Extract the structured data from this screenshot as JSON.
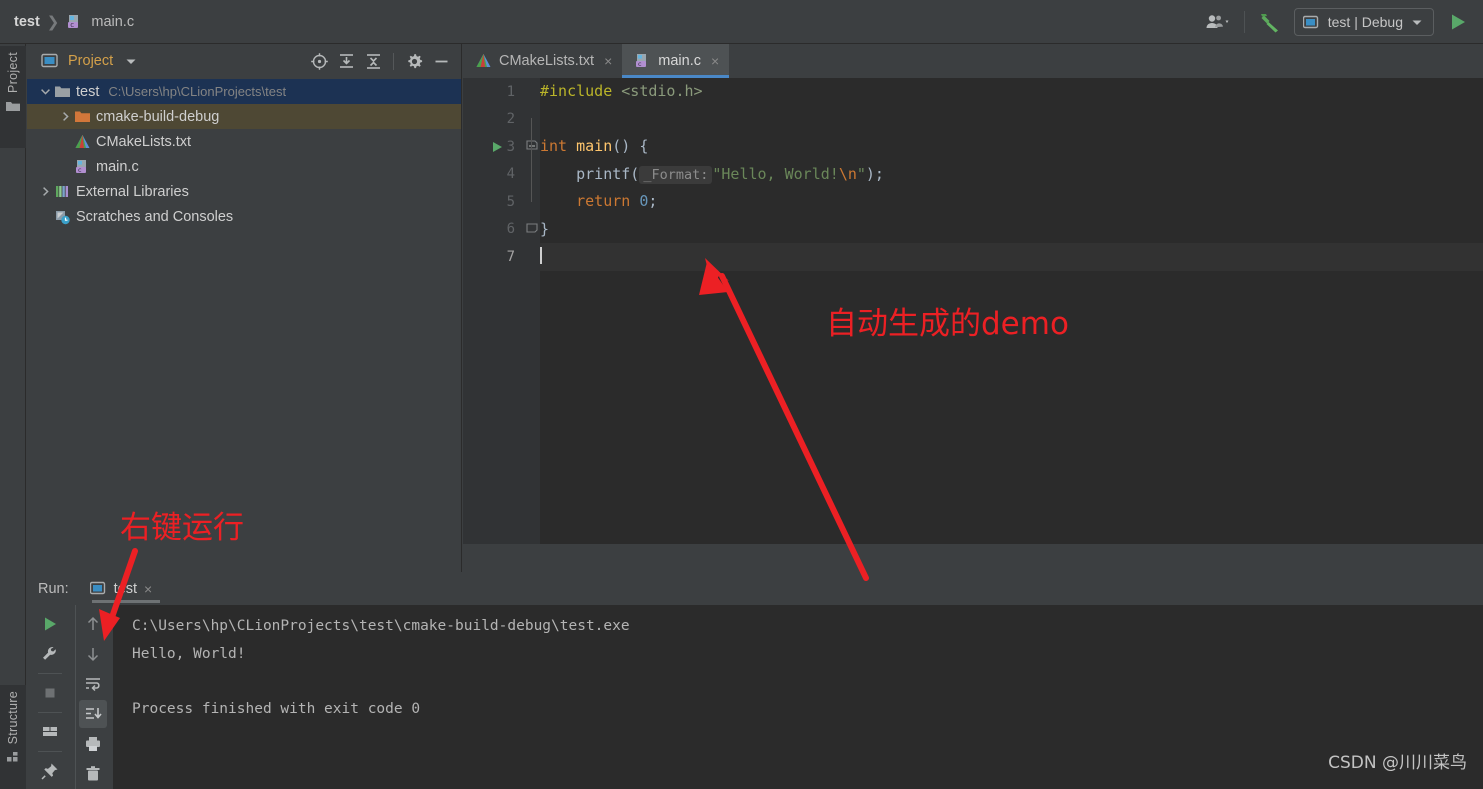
{
  "window": {
    "title_breadcrumb": [
      "test",
      "main.c"
    ]
  },
  "topbar": {
    "user_icon": "users-icon",
    "build_icon": "build-hammer-icon",
    "run_config": {
      "icon": "run-config-icon",
      "label": "test | Debug",
      "chevron": "chevron-down-icon"
    },
    "run_icon": "run-triangle-icon"
  },
  "left_strip": {
    "project_tab": "Project",
    "structure_tab": "Structure"
  },
  "project_panel": {
    "title": "Project",
    "chevron": "chevron-down-icon",
    "tools": [
      {
        "name": "locate-target-icon",
        "tip": "Select Opened File"
      },
      {
        "name": "expand-all-icon",
        "tip": "Expand All"
      },
      {
        "name": "collapse-all-icon",
        "tip": "Collapse All"
      },
      {
        "name": "gear-icon",
        "tip": "Settings"
      },
      {
        "name": "minimize-icon",
        "tip": "Hide"
      }
    ],
    "tree": [
      {
        "label": "test",
        "sub": "C:\\Users\\hp\\CLionProjects\\test",
        "icon": "folder-icon",
        "arrow": "expanded",
        "depth": 0,
        "state": "selected"
      },
      {
        "label": "cmake-build-debug",
        "sub": "",
        "icon": "folder-orange-icon",
        "arrow": "collapsed",
        "depth": 1,
        "state": "hovered"
      },
      {
        "label": "CMakeLists.txt",
        "sub": "",
        "icon": "cmake-file-icon",
        "arrow": "none",
        "depth": 1,
        "state": "normal"
      },
      {
        "label": "main.c",
        "sub": "",
        "icon": "c-file-icon",
        "arrow": "none",
        "depth": 1,
        "state": "normal"
      },
      {
        "label": "External Libraries",
        "sub": "",
        "icon": "libraries-icon",
        "arrow": "collapsed",
        "depth": 0,
        "state": "normal"
      },
      {
        "label": "Scratches and Consoles",
        "sub": "",
        "icon": "scratches-icon",
        "arrow": "none",
        "depth": 0,
        "state": "normal"
      }
    ]
  },
  "editor": {
    "tabs": [
      {
        "label": "CMakeLists.txt",
        "icon": "cmake-file-icon",
        "active": false,
        "close": "×"
      },
      {
        "label": "main.c",
        "icon": "c-file-icon",
        "active": true,
        "close": "×"
      }
    ],
    "line_numbers": [
      "1",
      "2",
      "3",
      "4",
      "5",
      "6",
      "7"
    ],
    "current_line": "7",
    "run_gutter_line": "3",
    "code_lines": [
      {
        "n": "1",
        "tokens": [
          {
            "t": "#include",
            "c": "pp"
          },
          {
            "t": " ",
            "c": "id"
          },
          {
            "t": "<stdio.h>",
            "c": "hdr"
          }
        ]
      },
      {
        "n": "2",
        "tokens": []
      },
      {
        "n": "3",
        "tokens": [
          {
            "t": "int",
            "c": "kw"
          },
          {
            "t": " ",
            "c": "id"
          },
          {
            "t": "main",
            "c": "fn"
          },
          {
            "t": "() {",
            "c": "punct"
          }
        ]
      },
      {
        "n": "4",
        "tokens": [
          {
            "t": "    printf(",
            "c": "id"
          },
          {
            "t": "_Format:",
            "c": "hint"
          },
          {
            "t": "\"Hello, World!",
            "c": "str"
          },
          {
            "t": "\\n",
            "c": "esc"
          },
          {
            "t": "\"",
            "c": "str"
          },
          {
            "t": ");",
            "c": "punct"
          }
        ]
      },
      {
        "n": "5",
        "tokens": [
          {
            "t": "    ",
            "c": "id"
          },
          {
            "t": "return",
            "c": "kw"
          },
          {
            "t": " ",
            "c": "id"
          },
          {
            "t": "0",
            "c": "num"
          },
          {
            "t": ";",
            "c": "punct"
          }
        ]
      },
      {
        "n": "6",
        "tokens": [
          {
            "t": "}",
            "c": "punct"
          }
        ]
      },
      {
        "n": "7",
        "tokens": []
      }
    ]
  },
  "run_panel": {
    "label": "Run:",
    "tab_name": "test",
    "tab_icon": "run-config-icon",
    "tab_close": "×",
    "left_tools": [
      {
        "name": "rerun-icon",
        "active": false
      },
      {
        "name": "wrench-settings-icon",
        "active": false
      },
      {
        "name": "stop-icon",
        "active": false
      },
      {
        "name": "layout-icon",
        "active": false
      },
      {
        "name": "pin-icon",
        "active": false
      }
    ],
    "right_tools": [
      {
        "name": "scroll-up-icon",
        "active": false
      },
      {
        "name": "scroll-down-icon",
        "active": false
      },
      {
        "name": "soft-wrap-icon",
        "active": false
      },
      {
        "name": "scroll-to-end-icon",
        "active": true
      },
      {
        "name": "print-icon",
        "active": false
      },
      {
        "name": "trash-icon",
        "active": false
      }
    ],
    "console_lines": [
      "C:\\Users\\hp\\CLionProjects\\test\\cmake-build-debug\\test.exe",
      "Hello, World!",
      "",
      "Process finished with exit code 0"
    ]
  },
  "annotations": {
    "demo_note": "自动生成的demo",
    "run_note": "右键运行",
    "color": "#ec2024"
  },
  "watermark": "CSDN @川川菜鸟"
}
